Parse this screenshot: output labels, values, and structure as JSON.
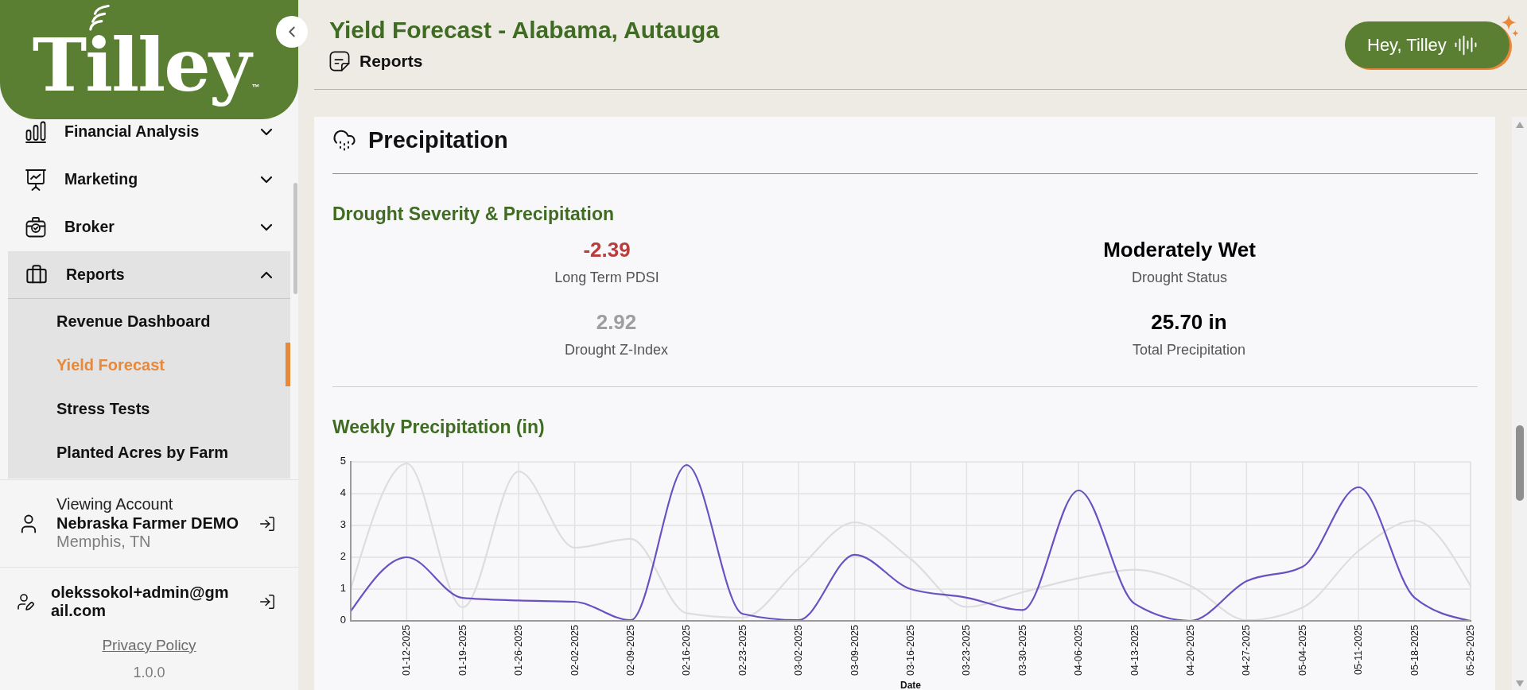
{
  "sidebar": {
    "logo": {
      "text": "Tilley",
      "mark": "™"
    },
    "nav": [
      {
        "label": "Financial Analysis",
        "expanded": false
      },
      {
        "label": "Marketing",
        "expanded": false
      },
      {
        "label": "Broker",
        "expanded": false
      },
      {
        "label": "Reports",
        "expanded": true,
        "children": [
          {
            "label": "Revenue Dashboard",
            "selected": false
          },
          {
            "label": "Yield Forecast",
            "selected": true
          },
          {
            "label": "Stress Tests",
            "selected": false
          },
          {
            "label": "Planted Acres by Farm",
            "selected": false
          }
        ]
      }
    ],
    "viewing_account": {
      "caption": "Viewing Account",
      "name": "Nebraska Farmer DEMO",
      "location": "Memphis, TN"
    },
    "user": {
      "email": "olekssokol+admin@gmail.com"
    },
    "privacy_link": "Privacy Policy",
    "version": "1.0.0"
  },
  "header": {
    "title": "Yield Forecast - Alabama, Autauga",
    "breadcrumb": "Reports",
    "assistant_button": "Hey, Tilley"
  },
  "section": {
    "title": "Precipitation",
    "drought": {
      "title": "Drought Severity & Precipitation",
      "stats": [
        {
          "value": "-2.39",
          "label": "Long Term PDSI",
          "color": "#b83d3d"
        },
        {
          "value": "Moderately Wet",
          "label": "Drought Status",
          "color": "#000000"
        },
        {
          "value": "2.92",
          "label": "Drought Z-Index",
          "color": "#9e9e9e"
        },
        {
          "value": "25.70 in",
          "label": "Total Precipitation",
          "color": "#000000"
        }
      ]
    },
    "weekly": {
      "title": "Weekly Precipitation (in)",
      "chart_data": {
        "type": "line",
        "xlabel": "Date",
        "grid": true,
        "categories": [
          null,
          "01-12-2025",
          "01-19-2025",
          "01-26-2025",
          "02-02-2025",
          "02-09-2025",
          "02-16-2025",
          "02-23-2025",
          "03-02-2025",
          "03-09-2025",
          "03-16-2025",
          "03-23-2025",
          "03-30-2025",
          "04-06-2025",
          "04-13-2025",
          "04-20-2025",
          "04-27-2025",
          "05-04-2025",
          "05-11-2025",
          "05-18-2025",
          "05-25-2025"
        ],
        "series": [
          {
            "color": "#6a51c2",
            "values": [
              0.3,
              2.0,
              0.72,
              0.64,
              0.6,
              0.02,
              4.9,
              0.22,
              0.02,
              2.08,
              1.0,
              0.73,
              0.34,
              4.1,
              0.54,
              0.0,
              1.25,
              1.7,
              4.2,
              0.73,
              0.0
            ]
          },
          {
            "color": "#dddddd",
            "values": [
              1.0,
              4.95,
              0.42,
              4.7,
              2.3,
              2.58,
              0.24,
              0.1,
              1.65,
              3.1,
              1.95,
              0.44,
              0.9,
              1.34,
              1.61,
              1.1,
              0.02,
              0.42,
              2.2,
              3.15,
              1.1
            ]
          }
        ],
        "ylim": [
          0,
          5
        ],
        "yticks": [
          0,
          1,
          2,
          3,
          4,
          5
        ]
      }
    }
  }
}
